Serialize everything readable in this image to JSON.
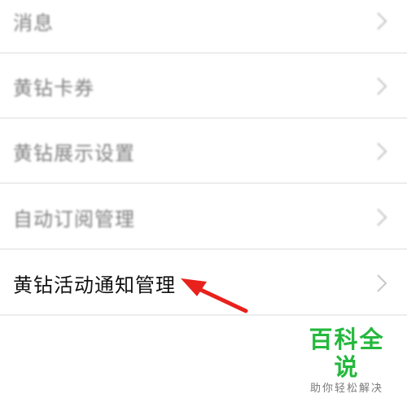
{
  "menu": {
    "items": [
      {
        "label": "消息",
        "focused": false
      },
      {
        "label": "黄钻卡券",
        "focused": false
      },
      {
        "label": "黄钻展示设置",
        "focused": false
      },
      {
        "label": "自动订阅管理",
        "focused": false
      },
      {
        "label": "黄钻活动通知管理",
        "focused": true
      }
    ],
    "chevron_icon": "chevron-right-icon"
  },
  "annotation": {
    "icon": "red-arrow-pointer-icon",
    "color": "#e8211c"
  },
  "watermark": {
    "brand": "百科全说",
    "slogan": "助你轻松解决",
    "brand_color": "#24b83d"
  }
}
